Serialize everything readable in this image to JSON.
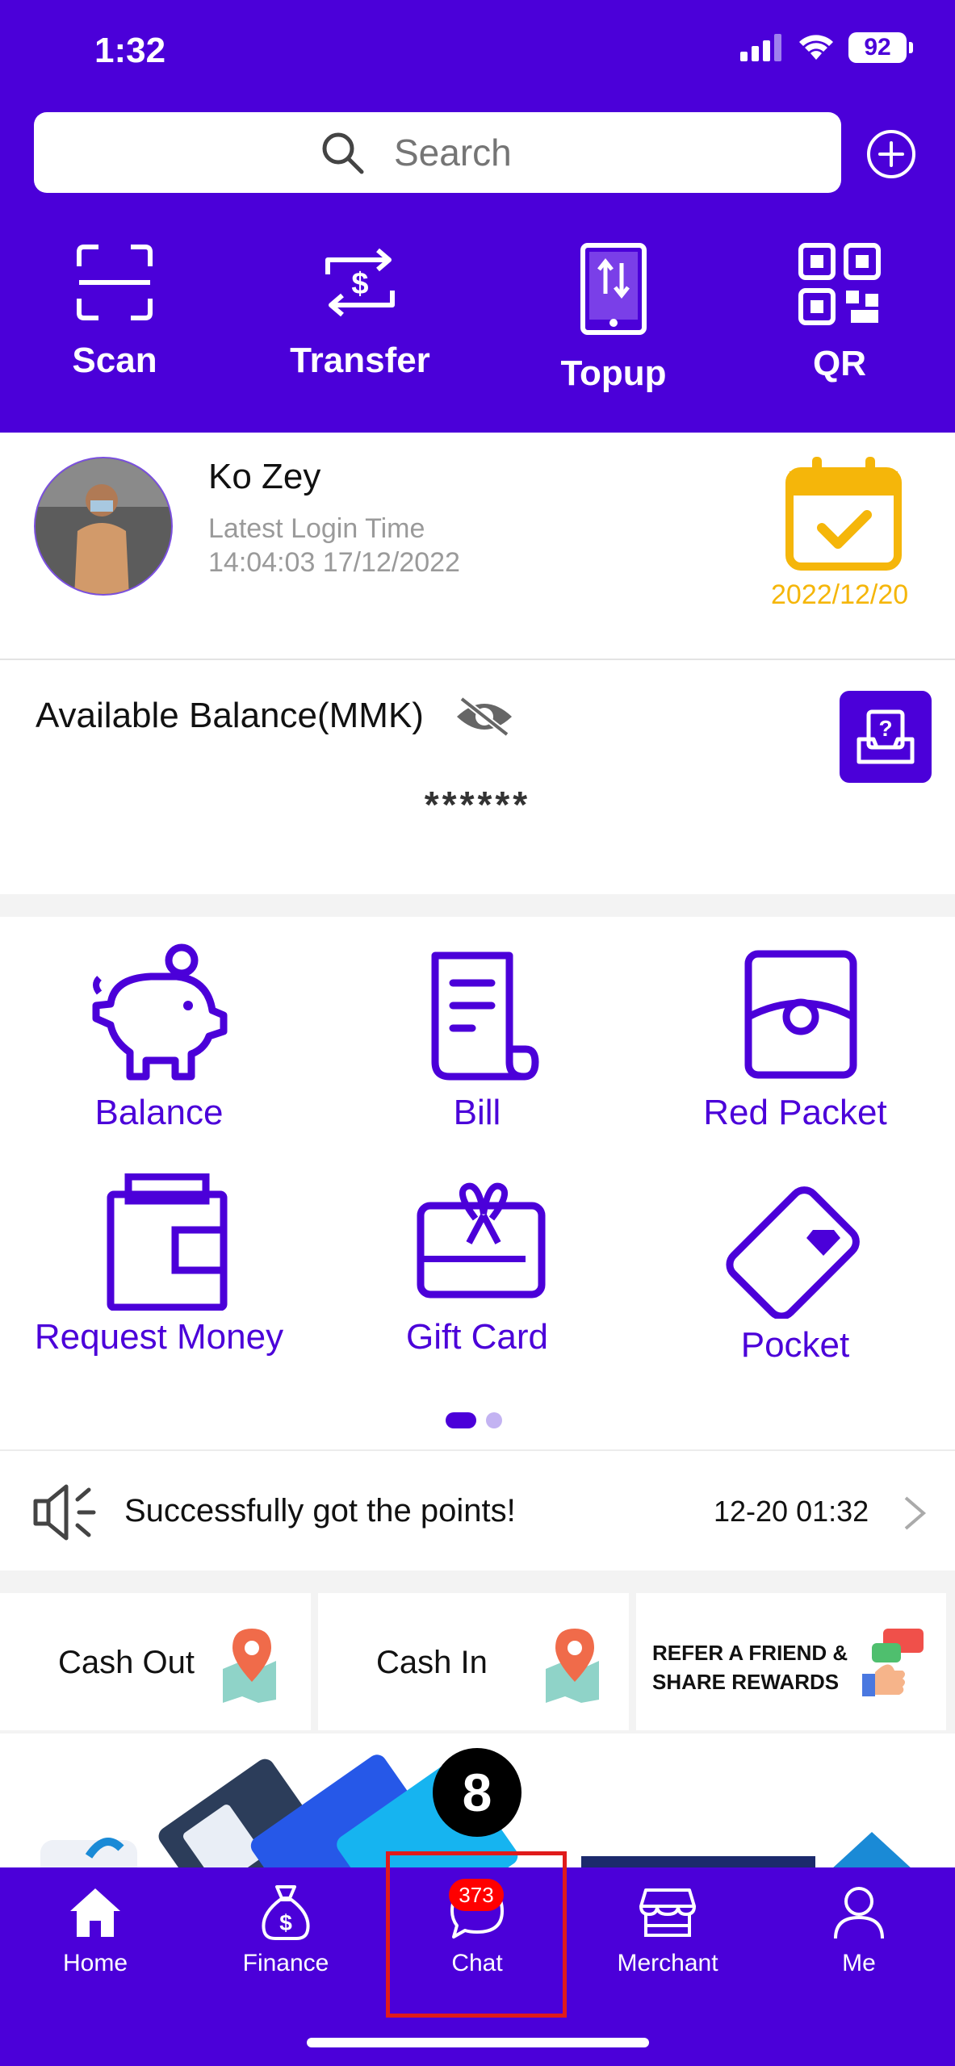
{
  "status_bar": {
    "time": "1:32",
    "battery": "92"
  },
  "search": {
    "placeholder": "Search"
  },
  "quick_actions": [
    {
      "label": "Scan",
      "icon": "scan-icon"
    },
    {
      "label": "Transfer",
      "icon": "transfer-icon"
    },
    {
      "label": "Topup",
      "icon": "topup-icon"
    },
    {
      "label": "QR",
      "icon": "qr-icon"
    }
  ],
  "profile": {
    "name": "Ko Zey",
    "login_label": "Latest Login Time",
    "login_time": "14:04:03 17/12/2022",
    "calendar_date": "2022/12/20"
  },
  "balance": {
    "label": "Available Balance(MMK)",
    "value": "******"
  },
  "services": [
    {
      "label": "Balance",
      "icon": "piggy-bank-icon"
    },
    {
      "label": "Bill",
      "icon": "bill-icon"
    },
    {
      "label": "Red Packet",
      "icon": "red-packet-icon"
    },
    {
      "label": "Request Money",
      "icon": "wallet-icon"
    },
    {
      "label": "Gift Card",
      "icon": "gift-card-icon"
    },
    {
      "label": "Pocket",
      "icon": "diamond-card-icon"
    }
  ],
  "notice": {
    "text": "Successfully got the points!",
    "time": "12-20 01:32"
  },
  "banners": [
    {
      "label": "Cash Out"
    },
    {
      "label": "Cash In"
    },
    {
      "label_line1": "REFER A FRIEND &",
      "label_line2": "SHARE REWARDS"
    }
  ],
  "step_marker": "8",
  "tabbar": {
    "items": [
      {
        "label": "Home",
        "icon": "home-icon"
      },
      {
        "label": "Finance",
        "icon": "money-bag-icon"
      },
      {
        "label": "Chat",
        "icon": "chat-icon",
        "badge": "373"
      },
      {
        "label": "Merchant",
        "icon": "store-icon"
      },
      {
        "label": "Me",
        "icon": "person-icon"
      }
    ]
  },
  "colors": {
    "primary": "#4b00d9",
    "accent_yellow": "#f5b60a",
    "badge_red": "#ff0000",
    "highlight_red": "#e01b1b"
  }
}
